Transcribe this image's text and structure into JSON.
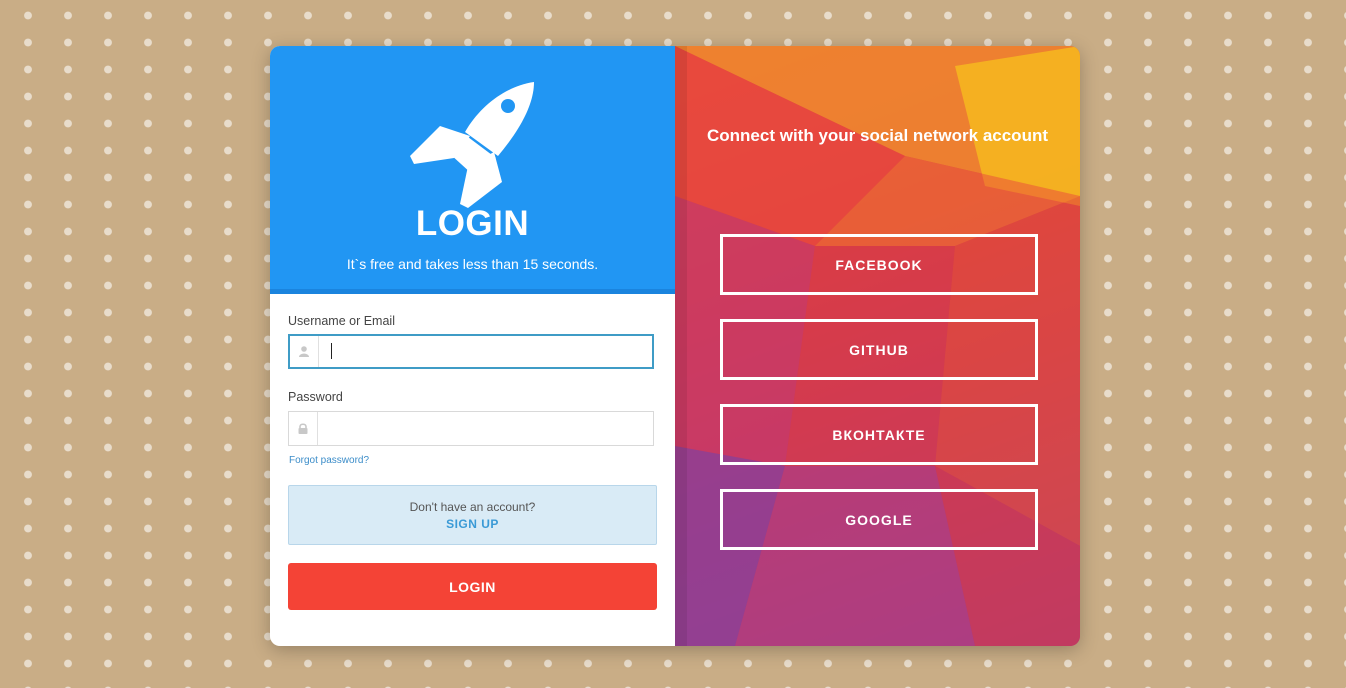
{
  "header": {
    "title": "LOGIN",
    "subtitle": "It`s free and takes less than 15 seconds."
  },
  "form": {
    "username_label": "Username or Email",
    "username_value": "",
    "password_label": "Password",
    "password_value": "",
    "forgot_link": "Forgot password?",
    "signup_question": "Don't have an account?",
    "signup_link": "SIGN UP",
    "login_button": "LOGIN"
  },
  "social": {
    "heading": "Connect with your social network account",
    "buttons": [
      "FACEBOOK",
      "GITHUB",
      "ВКОНТАКТЕ",
      "GOOGLE"
    ]
  },
  "icons": {
    "logo": "rocket-icon",
    "username": "user-icon",
    "password": "lock-icon"
  },
  "colors": {
    "header_blue": "#2196f3",
    "login_red": "#f44336",
    "link_blue": "#3a9ad6",
    "background": "#c9ad86"
  }
}
